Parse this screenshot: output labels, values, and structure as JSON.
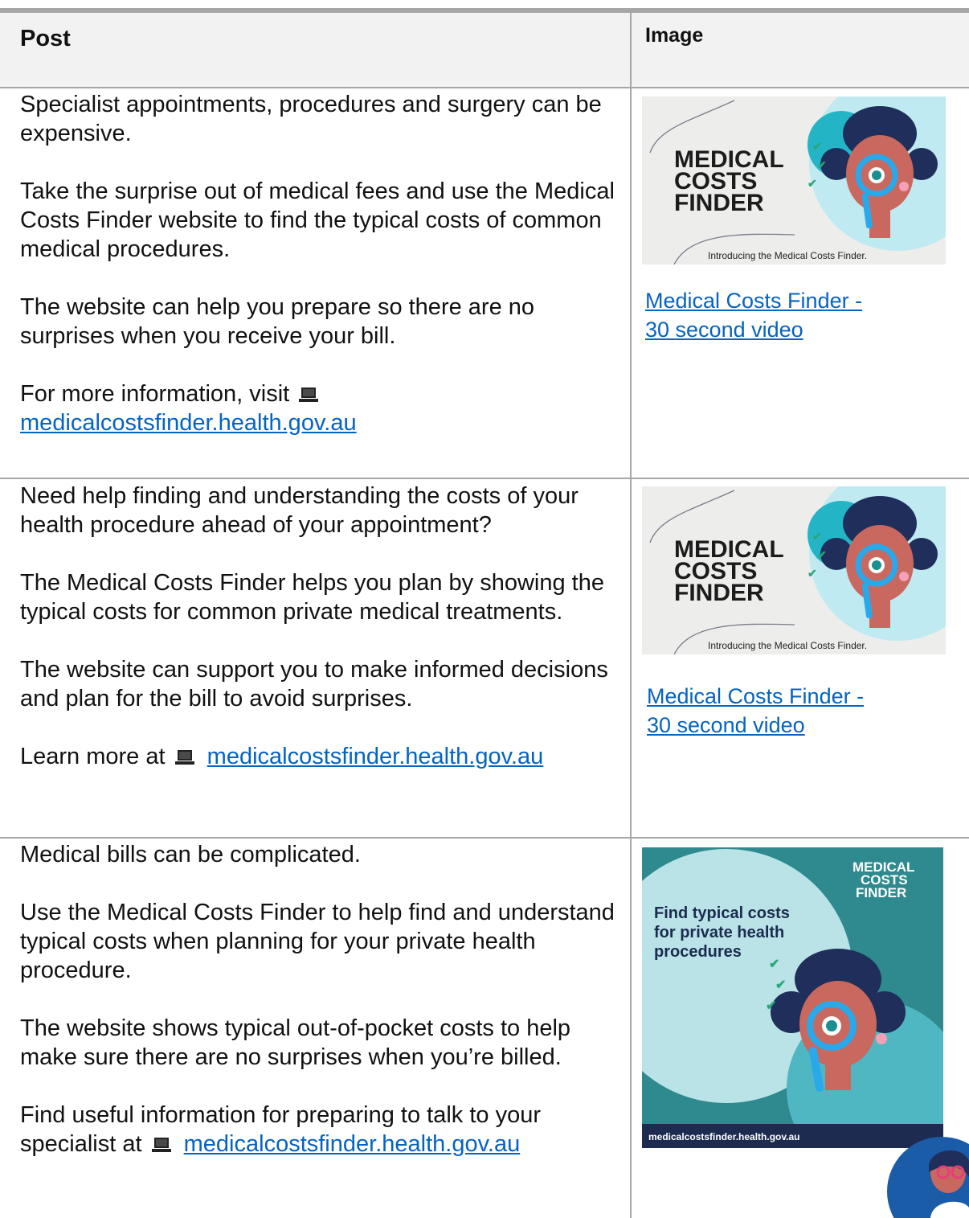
{
  "header": {
    "post": "Post",
    "image": "Image"
  },
  "rows": [
    {
      "paragraphs": [
        "Specialist appointments, procedures and surgery can be expensive.",
        "Take the surprise out of medical fees and use the Medical Costs Finder website to find the typical costs of common medical procedures.",
        "The website can help you prepare so there are no surprises when you receive your bill."
      ],
      "cta_prefix": "For more information, visit",
      "cta_link": "medicalcostsfinder.health.gov.au",
      "thumb": {
        "title_1": "MEDICAL",
        "title_2": "COSTS",
        "title_3": "FINDER",
        "caption": "Introducing the Medical Costs Finder."
      },
      "media_link": [
        "Medical Costs Finder -",
        "30 second video"
      ]
    },
    {
      "paragraphs": [
        "Need help finding and understanding the costs of your health procedure ahead of your appointment?",
        "The Medical Costs Finder helps you plan by showing the typical costs for common private medical treatments.",
        "The website can support you to make informed decisions and plan for the bill to avoid surprises."
      ],
      "cta_prefix": "Learn more at",
      "cta_link": "medicalcostsfinder.health.gov.au",
      "thumb": {
        "title_1": "MEDICAL",
        "title_2": "COSTS",
        "title_3": "FINDER",
        "caption": "Introducing the Medical Costs Finder."
      },
      "media_link": [
        "Medical Costs Finder -",
        "30 second video"
      ]
    },
    {
      "paragraphs": [
        "Medical bills can be complicated.",
        "Use the Medical Costs Finder to help find and understand typical costs when planning for your private health procedure.",
        "The website shows typical out-of-pocket costs to help make sure there are no surprises when you’re billed."
      ],
      "cta_prefix": "Find useful information for preparing to talk to your specialist at",
      "cta_link": "medicalcostsfinder.health.gov.au",
      "poster": {
        "title_1": "MEDICAL",
        "title_2": "COSTS",
        "title_3": "FINDER",
        "headline_1": "Find typical costs",
        "headline_2": "for private health",
        "headline_3": "procedures",
        "footer_url": "medicalcostsfinder.health.gov.au"
      }
    }
  ],
  "colors": {
    "link": "#0563c1",
    "border": "#a6a6a6",
    "header_bg": "#f2f2f2",
    "brand_teal": "#2e8a8e",
    "brand_navy": "#1c2b4f"
  },
  "icons": {
    "laptop": "laptop-icon"
  }
}
